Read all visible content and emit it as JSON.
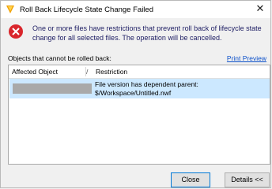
{
  "window": {
    "title": "Roll Back Lifecycle State Change Failed",
    "close_glyph": "✕"
  },
  "message": {
    "icon": "error-icon",
    "text": "One or more files have restrictions that prevent roll back of lifecycle state change for all selected files. The operation will be cancelled."
  },
  "objects": {
    "label": "Objects that cannot be rolled back:",
    "print_preview": "Print Preview"
  },
  "table": {
    "headers": [
      "Affected Object",
      "Restriction"
    ],
    "sort_mark": "/",
    "rows": [
      {
        "affected_object": "",
        "restriction_line1": "File version has dependent parent:",
        "restriction_line2": "$/Workspace/Untitled.nwf"
      }
    ]
  },
  "buttons": {
    "close": "Close",
    "details": "Details <<"
  },
  "colors": {
    "selection": "#cce8ff",
    "error_red": "#d9262c",
    "link": "#0a4fc9"
  }
}
